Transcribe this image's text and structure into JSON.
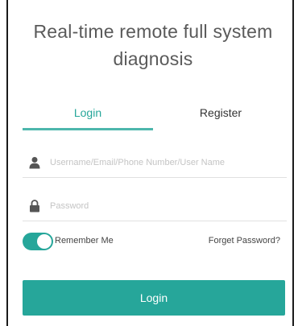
{
  "header": {
    "title": "Real-time remote full system diagnosis"
  },
  "tabs": [
    {
      "label": "Login",
      "active": true
    },
    {
      "label": "Register",
      "active": false
    }
  ],
  "form": {
    "username_placeholder": "Username/Email/Phone Number/User Name",
    "username_value": "",
    "password_placeholder": "Password",
    "password_value": "",
    "remember_me_label": "Remember Me",
    "remember_me_checked": true,
    "forgot_password_label": "Forget Password?",
    "submit_label": "Login"
  },
  "icons": {
    "username": "user-icon",
    "password": "lock-icon"
  },
  "colors": {
    "accent": "#26a69a",
    "tab_underline": "#4db6ac",
    "title_text": "#5a5a5a",
    "placeholder_text": "#c4c4c4"
  }
}
